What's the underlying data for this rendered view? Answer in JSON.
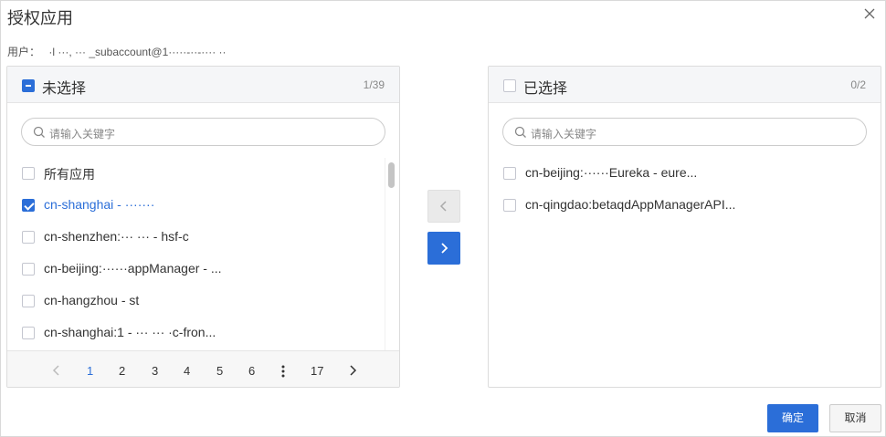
{
  "dialog": {
    "title": "授权应用",
    "close_icon": "close-icon",
    "user_label": "用户：",
    "user_value": "·l ···, ··· _subaccount@1·····-··-···· ··"
  },
  "left_panel": {
    "title": "未选择",
    "count": "1/39",
    "search_placeholder": "请输入关键字",
    "items": [
      {
        "label": "所有应用",
        "checked": false
      },
      {
        "label": "cn-shanghai - ·······",
        "checked": true
      },
      {
        "label": "cn-shenzhen:··· ··· - hsf-c",
        "checked": false
      },
      {
        "label": "cn-beijing:······appManager - ...",
        "checked": false
      },
      {
        "label": "cn-hangzhou - st",
        "checked": false
      },
      {
        "label": "cn-shanghai:1 - ··· ··· ·c-fron...",
        "checked": false
      }
    ],
    "pagination": {
      "prev_icon": "chevron-left-icon",
      "pages": [
        "1",
        "2",
        "3",
        "4",
        "5",
        "6"
      ],
      "current": "1",
      "more_icon": "ellipsis-vertical-icon",
      "last": "17",
      "next_icon": "chevron-right-icon"
    }
  },
  "right_panel": {
    "title": "已选择",
    "count": "0/2",
    "search_placeholder": "请输入关键字",
    "items": [
      {
        "label": "cn-beijing:······Eureka - eure...",
        "checked": false
      },
      {
        "label": "cn-qingdao:betaqdAppManagerAPI...",
        "checked": false
      }
    ]
  },
  "transfer": {
    "move_left_icon": "chevron-left-icon",
    "move_right_icon": "chevron-right-icon"
  },
  "footer": {
    "ok_label": "确定",
    "cancel_label": "取消"
  },
  "colors": {
    "primary": "#2b6ed8",
    "border": "#dcdcdc",
    "header_bg": "#f5f6f8"
  }
}
